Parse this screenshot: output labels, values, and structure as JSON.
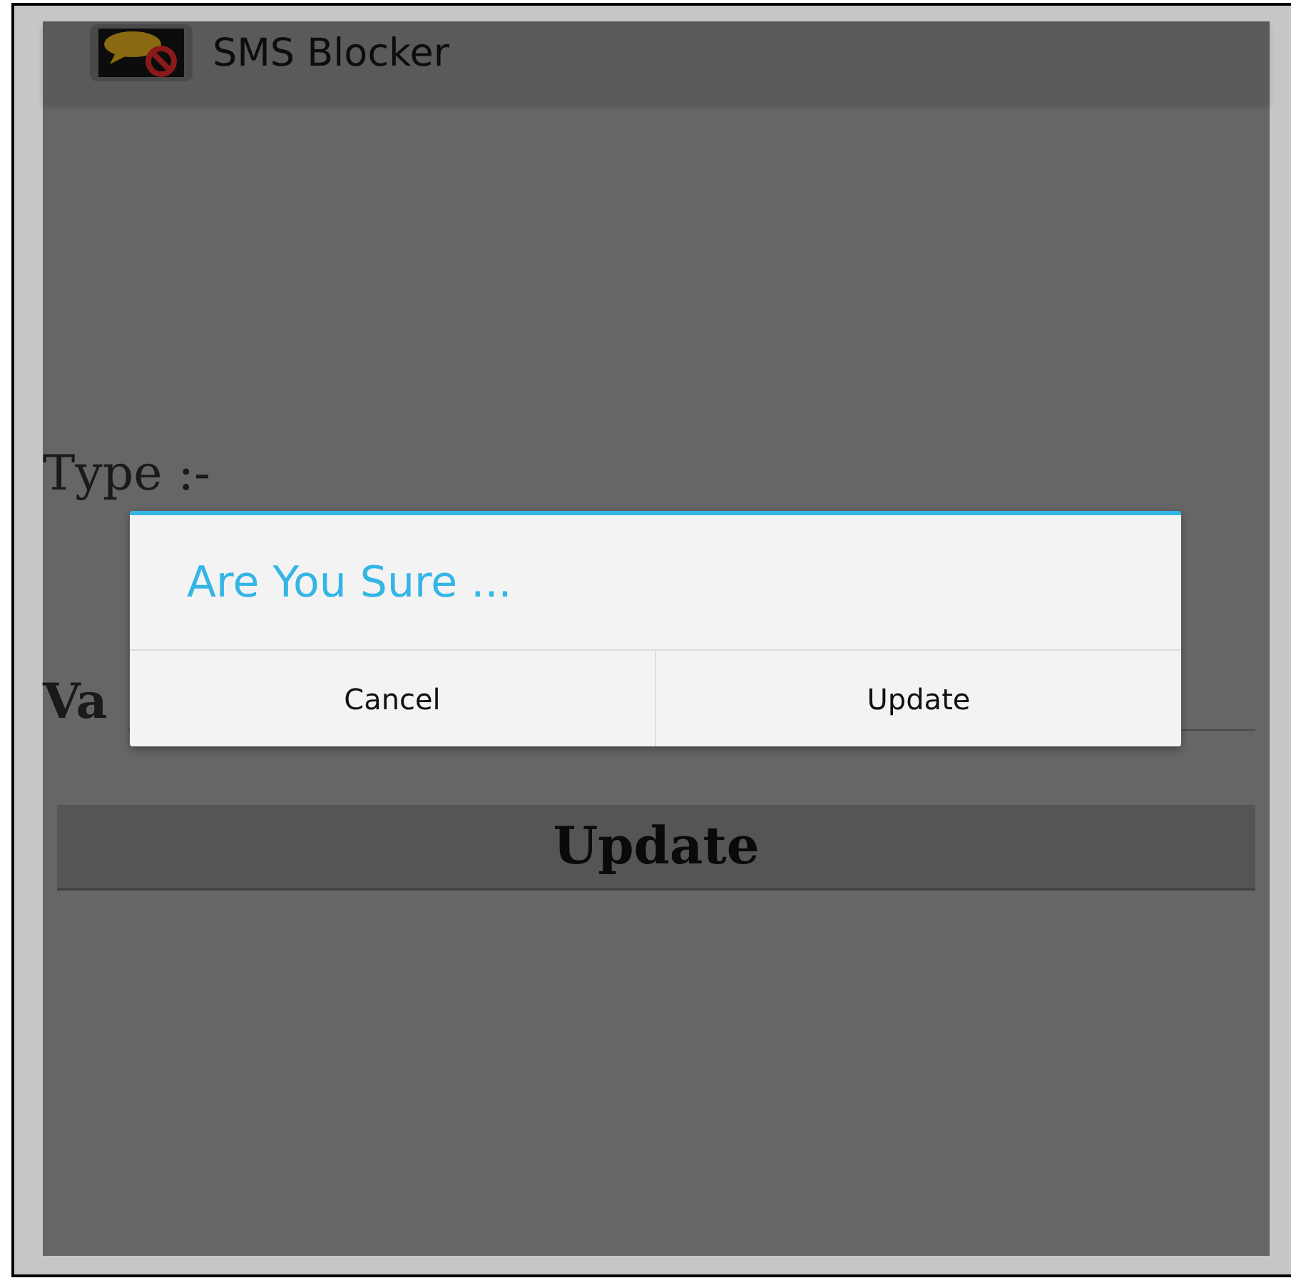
{
  "action_bar": {
    "title": "SMS Blocker"
  },
  "form": {
    "type_label": "Type :-",
    "value_label": "Va",
    "submit_button": "Update"
  },
  "dialog": {
    "title": "Are You Sure ...",
    "buttons": [
      {
        "label": "Cancel"
      },
      {
        "label": "Update"
      }
    ]
  }
}
